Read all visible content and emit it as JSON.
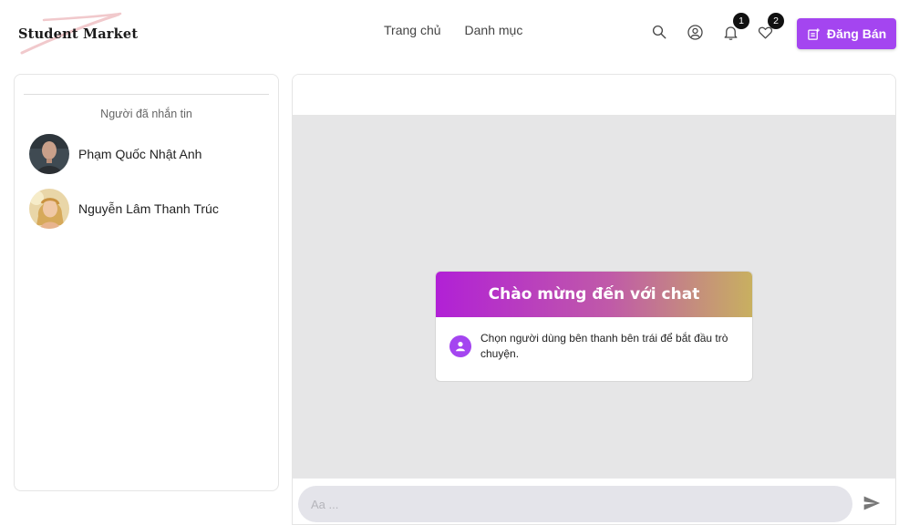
{
  "header": {
    "logo_text": "Student Market",
    "nav": [
      "Trang chủ",
      "Danh mục"
    ],
    "notifications_count": "1",
    "favorites_count": "2",
    "post_label": "Đăng Bán"
  },
  "sidebar": {
    "title": "Người đã nhắn tin",
    "contacts": [
      {
        "name": "Phạm Quốc Nhật Anh"
      },
      {
        "name": "Nguyễn Lâm Thanh Trúc"
      }
    ]
  },
  "chat": {
    "welcome_title": "Chào mừng đến với chat",
    "welcome_text": "Chọn người dùng bên thanh bên trái để bắt đầu trò chuyện.",
    "input_placeholder": "Aa ..."
  },
  "colors": {
    "accent": "#a445f0",
    "chat_background": "#e6e6e7"
  },
  "icons": [
    "search-icon",
    "user-circle-icon",
    "bell-icon",
    "heart-icon",
    "post-add-icon",
    "person-icon",
    "send-icon"
  ]
}
